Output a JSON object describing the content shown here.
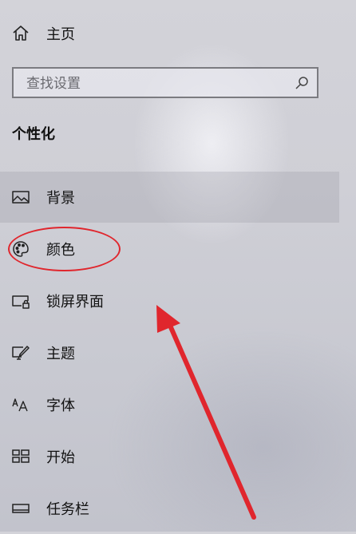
{
  "home": {
    "icon": "home-icon",
    "label": "主页"
  },
  "search": {
    "placeholder": "查找设置",
    "value": "",
    "icon": "search-icon"
  },
  "section": {
    "title": "个性化"
  },
  "nav": {
    "items": [
      {
        "label": "背景",
        "icon": "image-icon",
        "selected": true
      },
      {
        "label": "颜色",
        "icon": "palette-icon",
        "selected": false
      },
      {
        "label": "锁屏界面",
        "icon": "lock-screen-icon",
        "selected": false
      },
      {
        "label": "主题",
        "icon": "theme-icon",
        "selected": false
      },
      {
        "label": "字体",
        "icon": "font-icon",
        "selected": false
      },
      {
        "label": "开始",
        "icon": "start-icon",
        "selected": false
      },
      {
        "label": "任务栏",
        "icon": "taskbar-icon",
        "selected": false
      }
    ]
  },
  "annotation": {
    "color": "#e0262d",
    "highlighted_item": "颜色"
  }
}
